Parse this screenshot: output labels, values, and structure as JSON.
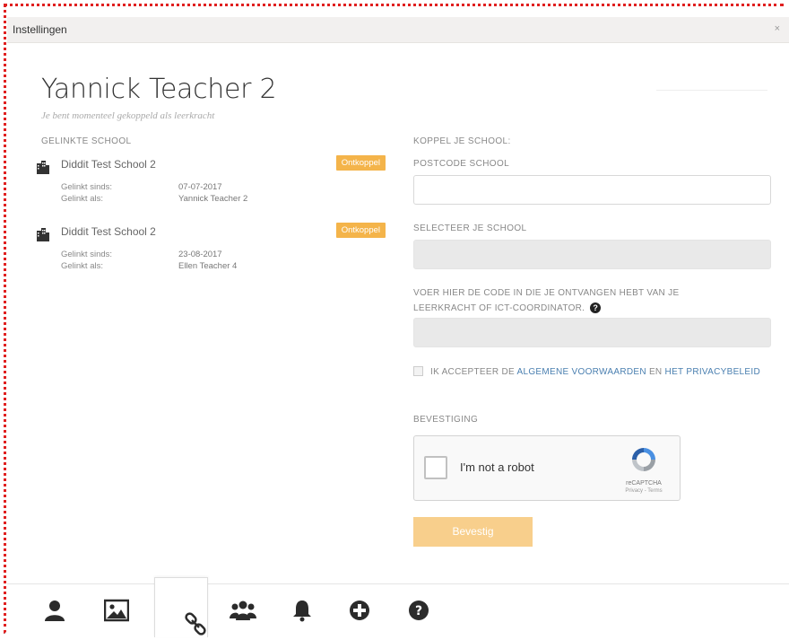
{
  "window": {
    "title": "Instellingen",
    "close": "×"
  },
  "profile": {
    "name": "Yannick Teacher 2",
    "subtitle": "Je bent momenteel gekoppeld als leerkracht"
  },
  "linked": {
    "label": "GELINKTE SCHOOL",
    "schools": [
      {
        "name": "Diddit Test School 2",
        "unlink": "Ontkoppel",
        "since_label": "Gelinkt sinds:",
        "since": "07-07-2017",
        "as_label": "Gelinkt als:",
        "as": "Yannick Teacher 2"
      },
      {
        "name": "Diddit Test School 2",
        "unlink": "Ontkoppel",
        "since_label": "Gelinkt sinds:",
        "since": "23-08-2017",
        "as_label": "Gelinkt als:",
        "as": "Ellen Teacher 4"
      }
    ]
  },
  "form": {
    "heading": "KOPPEL JE SCHOOL:",
    "postcode_label": "POSTCODE SCHOOL",
    "postcode_value": "",
    "school_label": "SELECTEER JE SCHOOL",
    "code_label": "VOER HIER DE CODE IN DIE JE ONTVANGEN HEBT VAN JE LEERKRACHT OF ICT-COORDINATOR.",
    "code_help": "?",
    "terms_prefix": "IK ACCEPTEER DE",
    "terms_link1": "ALGEMENE VOORWAARDEN",
    "terms_mid": "EN",
    "terms_link2": "HET PRIVACYBELEID",
    "confirm_label": "BEVESTIGING",
    "captcha_text": "I'm not a robot",
    "captcha_brand": "reCAPTCHA",
    "captcha_links": "Privacy - Terms",
    "submit": "Bevestig"
  },
  "tabs": [
    {
      "icon": "user-icon"
    },
    {
      "icon": "image-icon"
    },
    {
      "icon": "link-icon",
      "active": true
    },
    {
      "icon": "group-icon"
    },
    {
      "icon": "bell-icon"
    },
    {
      "icon": "plus-circle-icon"
    },
    {
      "icon": "question-circle-icon"
    }
  ]
}
